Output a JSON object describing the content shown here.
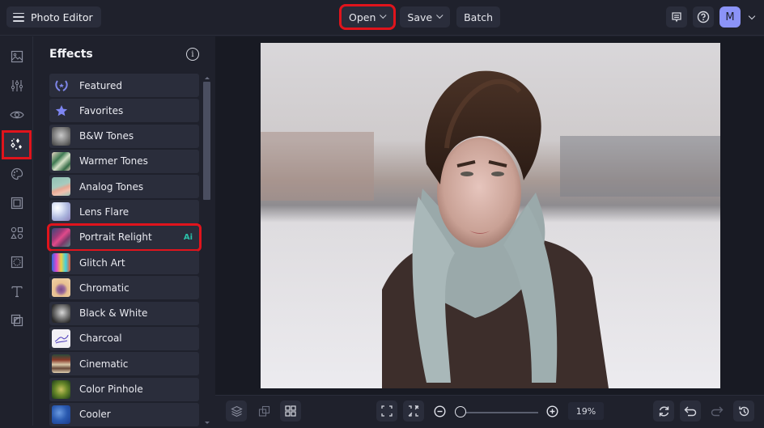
{
  "topbar": {
    "app_title": "Photo Editor",
    "buttons": [
      {
        "label": "Open",
        "has_dropdown": true
      },
      {
        "label": "Save",
        "has_dropdown": true
      },
      {
        "label": "Batch",
        "has_dropdown": false
      }
    ],
    "right_icons": [
      "feedback-icon",
      "help-icon"
    ],
    "avatar_initial": "M"
  },
  "left_rail": {
    "items": [
      {
        "name": "image-icon"
      },
      {
        "name": "adjust-sliders-icon"
      },
      {
        "name": "eye-icon"
      },
      {
        "name": "effects-sparkle-icon",
        "active": true
      },
      {
        "name": "palette-icon"
      },
      {
        "name": "frame-icon"
      },
      {
        "name": "shapes-icon"
      },
      {
        "name": "texture-icon"
      },
      {
        "name": "text-icon"
      },
      {
        "name": "overlay-icon"
      }
    ]
  },
  "panel": {
    "title": "Effects",
    "effects": [
      {
        "label": "Featured",
        "thumb": "laurel-icon"
      },
      {
        "label": "Favorites",
        "thumb": "star-icon"
      },
      {
        "label": "B&W Tones",
        "thumb": "bw-face"
      },
      {
        "label": "Warmer Tones",
        "thumb": "leaf"
      },
      {
        "label": "Analog Tones",
        "thumb": "flamingo"
      },
      {
        "label": "Lens Flare",
        "thumb": "flare"
      },
      {
        "label": "Portrait Relight",
        "thumb": "relight",
        "badge": "Ai",
        "highlighted": true
      },
      {
        "label": "Glitch Art",
        "thumb": "glitch"
      },
      {
        "label": "Chromatic",
        "thumb": "chromatic"
      },
      {
        "label": "Black & White",
        "thumb": "bw"
      },
      {
        "label": "Charcoal",
        "thumb": "charcoal"
      },
      {
        "label": "Cinematic",
        "thumb": "cinematic"
      },
      {
        "label": "Color Pinhole",
        "thumb": "pinhole"
      },
      {
        "label": "Cooler",
        "thumb": "cooler"
      }
    ]
  },
  "canvas": {
    "photo_description": "Young man with tousled brown hair and a grey checkered scarf in a snowy field"
  },
  "bottombar": {
    "zoom_value": "19%",
    "zoom_fraction": 0.0
  },
  "colors": {
    "accent": "#8b93f7",
    "highlight_border": "#e0141c",
    "ai_badge": "#2bbfa8",
    "background": "#1f212c",
    "button_bg": "#2a2d3b"
  }
}
